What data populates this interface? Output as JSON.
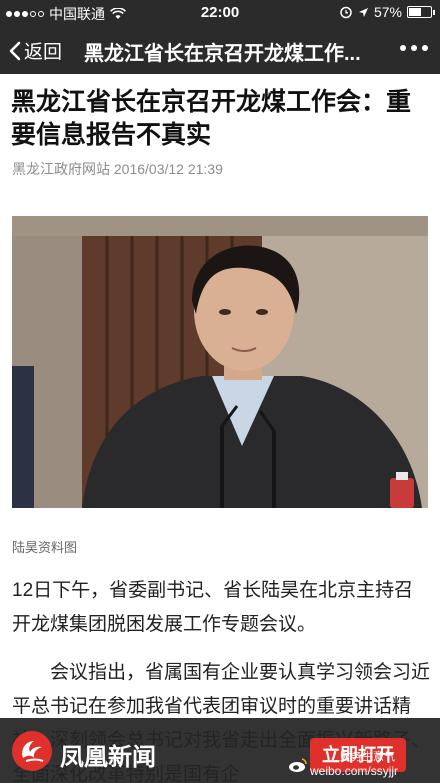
{
  "status_bar": {
    "carrier": "中国联通",
    "time": "22:00",
    "battery_percent_text": "57%",
    "battery_level": 0.57,
    "signal_bars_filled": 3,
    "signal_bars_total": 5
  },
  "nav": {
    "back_label": "返回",
    "title": "黑龙江省长在京召开龙煤工作..."
  },
  "article": {
    "headline": "黑龙江省长在京召开龙煤工作会：重要信息报告不真实",
    "source_time": "黑龙江政府网站 2016/03/12 21:39",
    "photo_caption": "陆昊资料图",
    "paragraph1": "12日下午，省委副书记、省长陆昊在北京主持召开龙煤集团脱困发展工作专题会议。",
    "paragraph2": "会议指出，省属国有企业要认真学习领会习近平总书记在参加我省代表团审议时的重要讲话精神，深刻领会总书记对我省走出全面振兴新路子、全面深化改革特别是国有企"
  },
  "banner": {
    "brand_name": "凤凰新闻",
    "open_button": "立即打开"
  },
  "watermark": {
    "line1": "财务生意气",
    "line2": "weibo.com/ssyjjr"
  },
  "colors": {
    "bar_bg": "#2b2b2b",
    "brand_red": "#e0302c"
  }
}
